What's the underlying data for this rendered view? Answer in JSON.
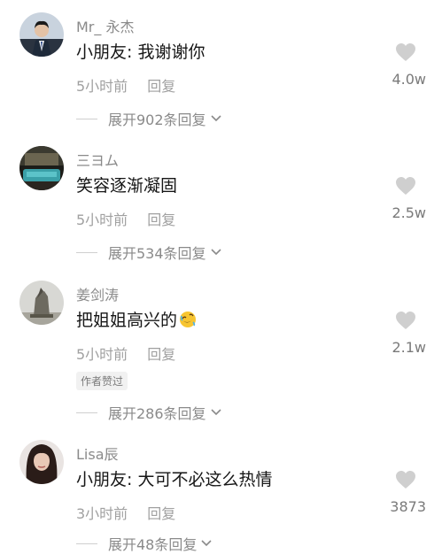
{
  "comments": [
    {
      "username": "Mr_ 永杰",
      "text": "小朋友: 我谢谢你",
      "time": "5小时前",
      "reply": "回复",
      "likes": "4.0w",
      "expand": "展开902条回复",
      "author_badge": null,
      "emoji": null
    },
    {
      "username": "三ヨム",
      "text": "笑容逐渐凝固",
      "time": "5小时前",
      "reply": "回复",
      "likes": "2.5w",
      "expand": "展开534条回复",
      "author_badge": null,
      "emoji": null
    },
    {
      "username": "姜剑涛",
      "text": "把姐姐高兴的",
      "time": "5小时前",
      "reply": "回复",
      "likes": "2.1w",
      "expand": "展开286条回复",
      "author_badge": "作者赞过",
      "emoji": "rolling-on-floor-laughing-emoji"
    },
    {
      "username": "Lisa辰",
      "text": "小朋友:  大可不必这么热情",
      "time": "3小时前",
      "reply": "回复",
      "likes": "3873",
      "expand": "展开48条回复",
      "author_badge": null,
      "emoji": null
    }
  ],
  "icons": {
    "like": "heart-icon",
    "expand": "chevron-down-icon"
  },
  "colors": {
    "text": "#161616",
    "meta": "#a0a0a0",
    "heart": "#cfcfcf"
  }
}
